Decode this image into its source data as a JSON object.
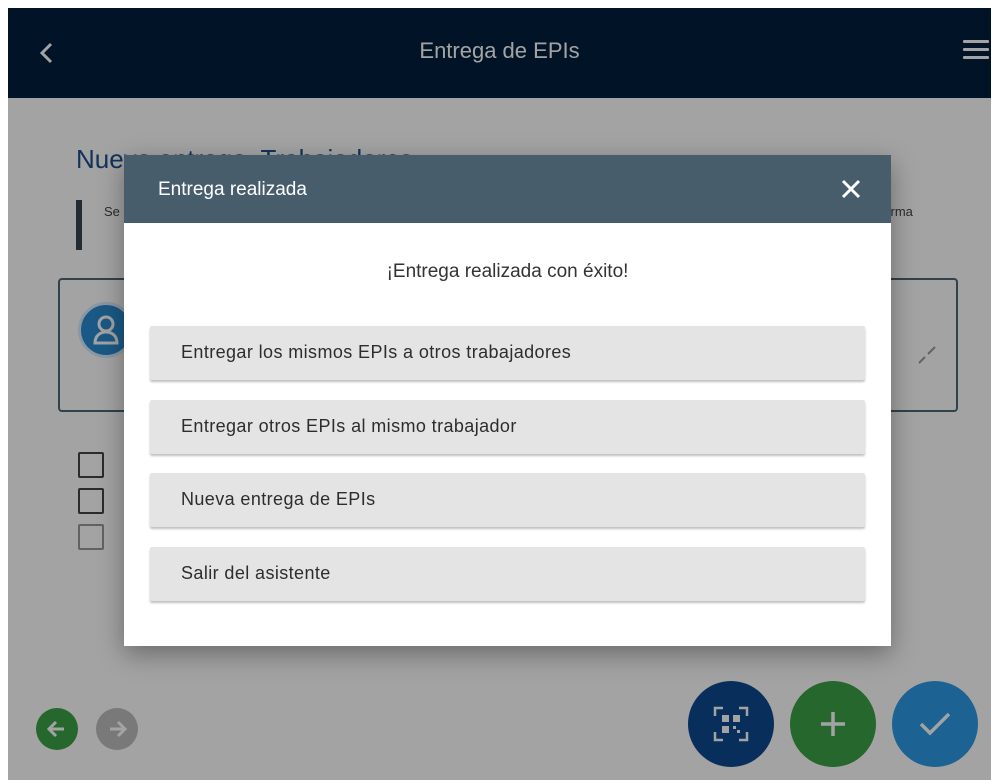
{
  "appbar": {
    "title": "Entrega de EPIs"
  },
  "page": {
    "title": "Nueva entrega. Trabajadores",
    "info_left": "Se de",
    "info_right": "firma"
  },
  "dialog": {
    "title": "Entrega realizada",
    "message": "¡Entrega realizada con éxito!",
    "options": [
      "Entregar los mismos EPIs a otros trabajadores",
      "Entregar otros EPIs al mismo trabajador",
      "Nueva entrega de EPIs",
      "Salir del asistente"
    ]
  },
  "colors": {
    "appbar": "#001f3e",
    "dialog_header": "#475d6c",
    "green": "#3aa146",
    "blue": "#2d9ce8",
    "navy": "#0e4a8f"
  },
  "icons": {
    "back": "chevron-left-icon",
    "menu": "hamburger-menu-icon",
    "close": "close-icon",
    "qr": "qr-code-icon",
    "add": "plus-icon",
    "confirm": "check-icon",
    "prev": "arrow-left-icon",
    "next": "arrow-right-icon"
  }
}
